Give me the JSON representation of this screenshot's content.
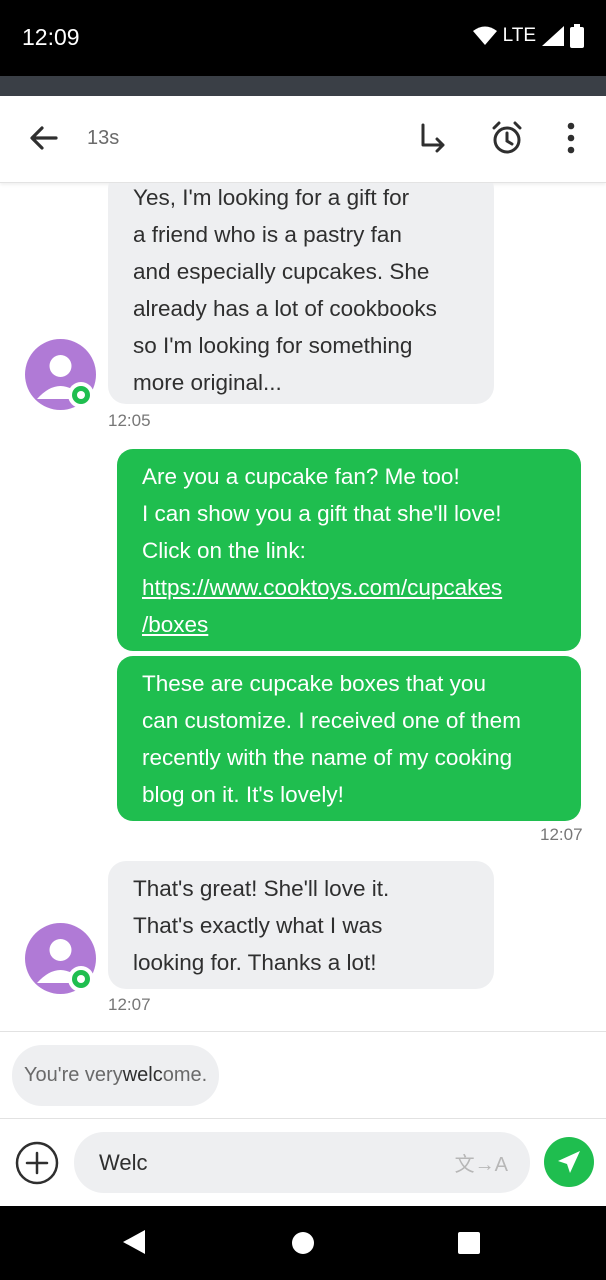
{
  "status": {
    "time": "12:09",
    "network": "LTE"
  },
  "header": {
    "title": "13s",
    "icons": [
      "back-arrow-icon",
      "reply-arrow-icon",
      "alarm-icon",
      "more-vert-icon"
    ]
  },
  "messages": [
    {
      "direction": "incoming",
      "lines": [
        "Yes, I'm looking for a gift for",
        "a friend who is a pastry fan",
        "and especially cupcakes. She",
        "already has a lot of cookbooks",
        "so I'm looking for something",
        "more original..."
      ],
      "time": "12:05"
    },
    {
      "direction": "outgoing",
      "lines": [
        "Are you a cupcake fan? Me too!",
        "I can show you a gift that she'll love!",
        "Click on the link:"
      ],
      "link_lines": [
        "https://www.cooktoys.com/cupcakes",
        "/boxes"
      ]
    },
    {
      "direction": "outgoing",
      "lines": [
        "These are cupcake boxes that you",
        "can customize. I received one of them",
        "recently with the name of my cooking",
        "blog on it. It's lovely!"
      ],
      "time": "12:07"
    },
    {
      "direction": "incoming",
      "lines": [
        "That's great! She'll love it.",
        "That's exactly what I was",
        "looking for. Thanks a lot!"
      ],
      "time": "12:07"
    }
  ],
  "suggestion": {
    "prefix": "You're very ",
    "match": "welc",
    "suffix": "ome."
  },
  "composer": {
    "value": "Welc",
    "translate_label": "文→A"
  },
  "colors": {
    "accent_green": "#1fbe4f",
    "avatar_purple": "#b07ad6",
    "incoming_bubble": "#eeeff1"
  }
}
